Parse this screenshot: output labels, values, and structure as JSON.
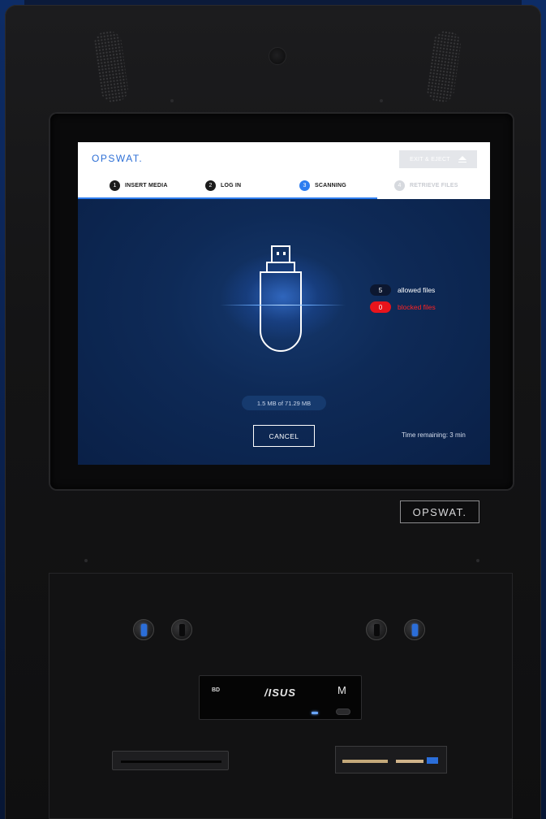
{
  "app": {
    "logo": "OPSWAT.",
    "exit_button": "EXIT & EJECT"
  },
  "steps": [
    {
      "num": "1",
      "label": "INSERT MEDIA",
      "state": "done"
    },
    {
      "num": "2",
      "label": "LOG IN",
      "state": "done"
    },
    {
      "num": "3",
      "label": "SCANNING",
      "state": "active"
    },
    {
      "num": "4",
      "label": "RETRIEVE FILES",
      "state": "disabled"
    }
  ],
  "scan": {
    "allowed_count": "5",
    "allowed_label": "allowed files",
    "blocked_count": "0",
    "blocked_label": "blocked files",
    "progress_text": "1.5 MB of 71.29 MB",
    "cancel_label": "CANCEL",
    "time_remaining": "Time remaining: 3 min"
  },
  "hardware": {
    "brand_plate": "OPSWAT.",
    "optical_brand": "/ISUS",
    "optical_logo": "M"
  },
  "colors": {
    "accent": "#2d7df0",
    "blocked": "#e8141c",
    "screen_bg": "#0e2a57"
  },
  "icons": [
    "eject-icon",
    "usb-drive-icon"
  ]
}
